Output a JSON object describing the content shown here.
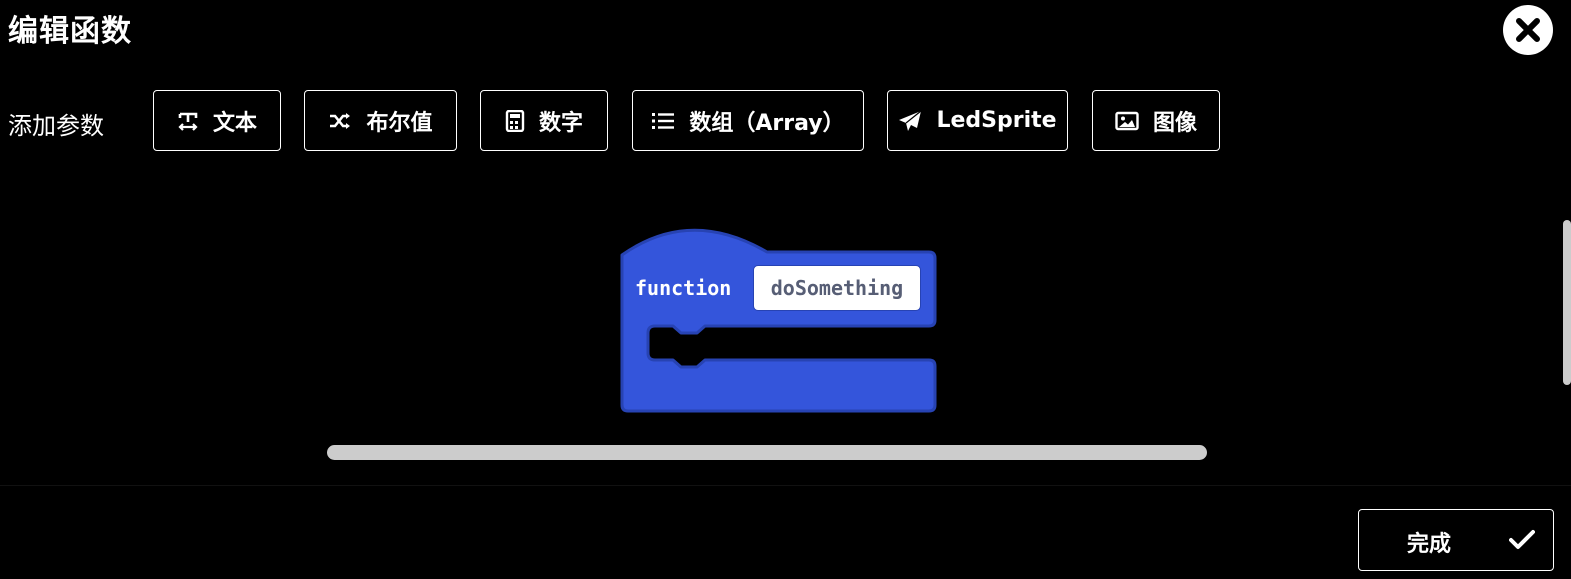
{
  "dialog": {
    "title": "编辑函数",
    "close_icon": "close-icon"
  },
  "params": {
    "label": "添加参数",
    "buttons": [
      {
        "label": "文本",
        "icon": "text-icon"
      },
      {
        "label": "布尔值",
        "icon": "shuffle-icon"
      },
      {
        "label": "数字",
        "icon": "calculator-icon"
      },
      {
        "label": "数组（Array）",
        "icon": "list-icon"
      },
      {
        "label": "LedSprite",
        "icon": "paper-plane-icon"
      },
      {
        "label": "图像",
        "icon": "image-icon"
      }
    ]
  },
  "block": {
    "keyword": "function",
    "name": "doSomething",
    "color": "#3455db",
    "border_color": "#2743b3"
  },
  "footer": {
    "done_label": "完成",
    "done_icon": "checkmark-icon"
  }
}
